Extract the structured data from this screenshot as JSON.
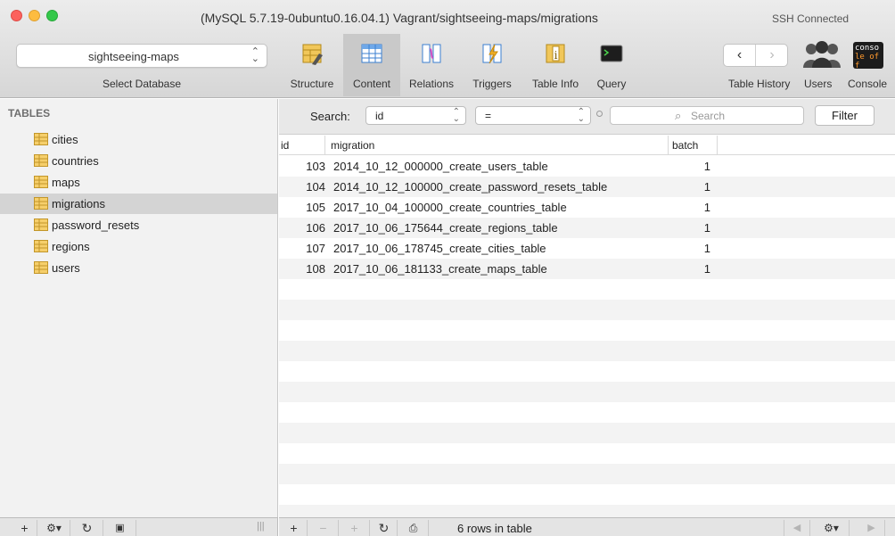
{
  "window": {
    "title": "(MySQL 5.7.19-0ubuntu0.16.04.1) Vagrant/sightseeing-maps/migrations",
    "ssh_status": "SSH Connected"
  },
  "database": {
    "selected": "sightseeing-maps",
    "label": "Select Database"
  },
  "toolbar": {
    "items": [
      {
        "label": "Structure",
        "icon": "structure-icon"
      },
      {
        "label": "Content",
        "icon": "content-icon",
        "active": true
      },
      {
        "label": "Relations",
        "icon": "relations-icon"
      },
      {
        "label": "Triggers",
        "icon": "triggers-icon"
      },
      {
        "label": "Table Info",
        "icon": "table-info-icon"
      },
      {
        "label": "Query",
        "icon": "terminal-icon"
      }
    ],
    "table_history_label": "Table History",
    "users_label": "Users",
    "console_label": "Console",
    "console_badge": "conso le off",
    "back_glyph": "‹",
    "forward_glyph": "›"
  },
  "sidebar": {
    "heading": "TABLES",
    "tables": [
      "cities",
      "countries",
      "maps",
      "migrations",
      "password_resets",
      "regions",
      "users"
    ],
    "selected_index": 3
  },
  "filter": {
    "search_label": "Search:",
    "field": "id",
    "operator": "=",
    "search_placeholder": "Search",
    "filter_button": "Filter"
  },
  "grid": {
    "columns": [
      "id",
      "migration",
      "batch"
    ],
    "rows": [
      {
        "id": "103",
        "migration": "2014_10_12_000000_create_users_table",
        "batch": "1"
      },
      {
        "id": "104",
        "migration": "2014_10_12_100000_create_password_resets_table",
        "batch": "1"
      },
      {
        "id": "105",
        "migration": "2017_10_04_100000_create_countries_table",
        "batch": "1"
      },
      {
        "id": "106",
        "migration": "2017_10_06_175644_create_regions_table",
        "batch": "1"
      },
      {
        "id": "107",
        "migration": "2017_10_06_178745_create_cities_table",
        "batch": "1"
      },
      {
        "id": "108",
        "migration": "2017_10_06_181133_create_maps_table",
        "batch": "1"
      }
    ]
  },
  "statusbar": {
    "row_count": "6 rows in table",
    "add": "+",
    "remove": "−",
    "duplicate": "+",
    "refresh": "↻",
    "gear": "⚙▾",
    "prev": "◀",
    "next": "▶"
  },
  "colors": {
    "accent": "#c9c9c9",
    "selected_row": "#d4d4d4",
    "table_icon": "#e8b84a"
  }
}
